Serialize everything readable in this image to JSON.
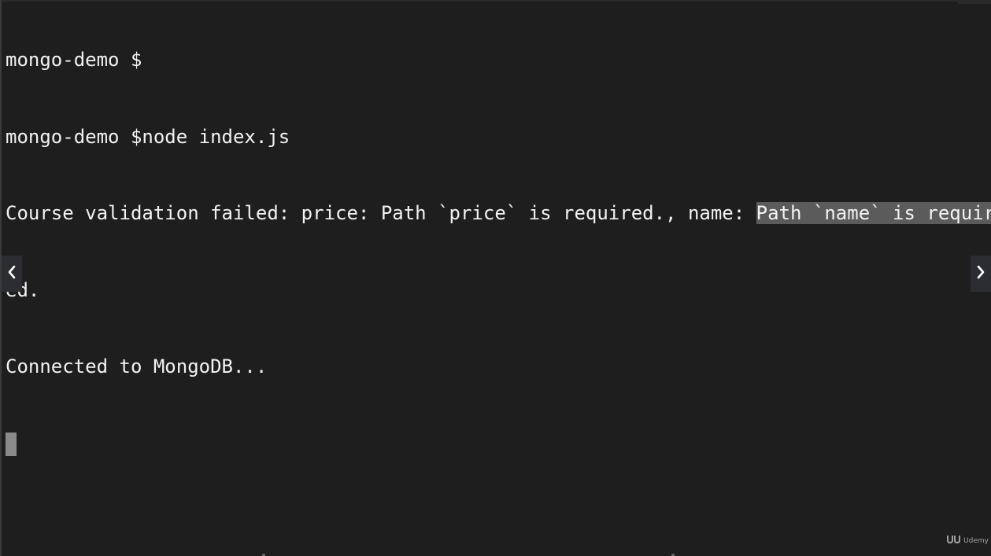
{
  "terminal": {
    "lines": [
      "mongo-demo $",
      "mongo-demo $node index.js",
      "ed.",
      "Connected to MongoDB..."
    ],
    "error_line": {
      "before_highlight": "Course validation failed: price: Path `price` is required., name: ",
      "highlighted": "Path `name` is requir"
    }
  },
  "navigation": {
    "prev_icon": "chevron-left-icon",
    "next_icon": "chevron-right-icon"
  },
  "watermark": {
    "logo_icon": "udemy-logo-icon",
    "text": "Udemy"
  },
  "colors": {
    "background": "#1e1e1e",
    "text": "#f2f2f2",
    "selection": "#5b5b5b",
    "cursor": "#8a8a8a"
  }
}
